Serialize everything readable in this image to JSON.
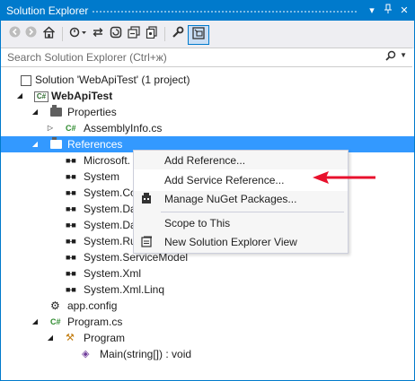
{
  "window": {
    "title": "Solution Explorer",
    "pin_icon": "pin-icon",
    "close_icon": "close-icon",
    "dropdown_icon": "dropdown-icon"
  },
  "search": {
    "placeholder": "Search Solution Explorer (Ctrl+ж)"
  },
  "tree": {
    "solution": "Solution 'WebApiTest' (1 project)",
    "project": "WebApiTest",
    "properties": "Properties",
    "assemblyinfo": "AssemblyInfo.cs",
    "references": "References",
    "refs": [
      "Microsoft.",
      "System",
      "System.Co",
      "System.Da",
      "System.Da",
      "System.Ru",
      "System.ServiceModel",
      "System.Xml",
      "System.Xml.Linq"
    ],
    "appconfig": "app.config",
    "programcs": "Program.cs",
    "program": "Program",
    "main": "Main(string[]) : void"
  },
  "context_menu": {
    "items": [
      "Add Reference...",
      "Add Service Reference...",
      "Manage NuGet Packages...",
      "Scope to This",
      "New Solution Explorer View"
    ]
  },
  "colors": {
    "accent": "#007acc",
    "selection": "#3399ff",
    "arrow": "#e8112d"
  }
}
